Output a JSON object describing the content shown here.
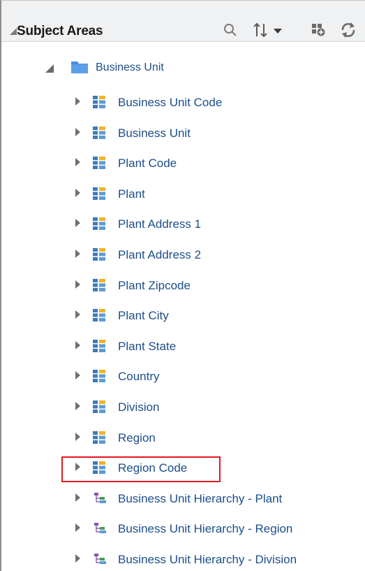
{
  "header": {
    "title": "Subject Areas",
    "toolbar_icons": [
      "search-icon",
      "sort-icon",
      "add-icon",
      "refresh-icon"
    ]
  },
  "tree": {
    "root": {
      "label": "Business Unit",
      "icon": "folder-icon",
      "expanded": true
    },
    "items": [
      {
        "label": "Business Unit Code",
        "icon": "column-icon"
      },
      {
        "label": "Business Unit",
        "icon": "column-icon"
      },
      {
        "label": "Plant Code",
        "icon": "column-icon"
      },
      {
        "label": "Plant",
        "icon": "column-icon"
      },
      {
        "label": "Plant Address 1",
        "icon": "column-icon"
      },
      {
        "label": "Plant Address 2",
        "icon": "column-icon"
      },
      {
        "label": "Plant Zipcode",
        "icon": "column-icon"
      },
      {
        "label": "Plant City",
        "icon": "column-icon"
      },
      {
        "label": "Plant State",
        "icon": "column-icon"
      },
      {
        "label": "Country",
        "icon": "column-icon"
      },
      {
        "label": "Division",
        "icon": "column-icon"
      },
      {
        "label": "Region",
        "icon": "column-icon"
      },
      {
        "label": "Region Code",
        "icon": "column-icon",
        "highlighted": true
      },
      {
        "label": "Business Unit Hierarchy - Plant",
        "icon": "hierarchy-icon"
      },
      {
        "label": "Business Unit Hierarchy - Region",
        "icon": "hierarchy-icon"
      },
      {
        "label": "Business Unit Hierarchy - Division",
        "icon": "hierarchy-icon"
      }
    ]
  },
  "colors": {
    "link_text": "#1c4e8a",
    "header_bg": "#f0f1f2",
    "highlight_border": "#e0191f",
    "folder": "#4a90d9",
    "column_icon": "#3d7ab8",
    "column_icon_accent": "#f0b429",
    "hierarchy_icon": "#8a56a8"
  }
}
